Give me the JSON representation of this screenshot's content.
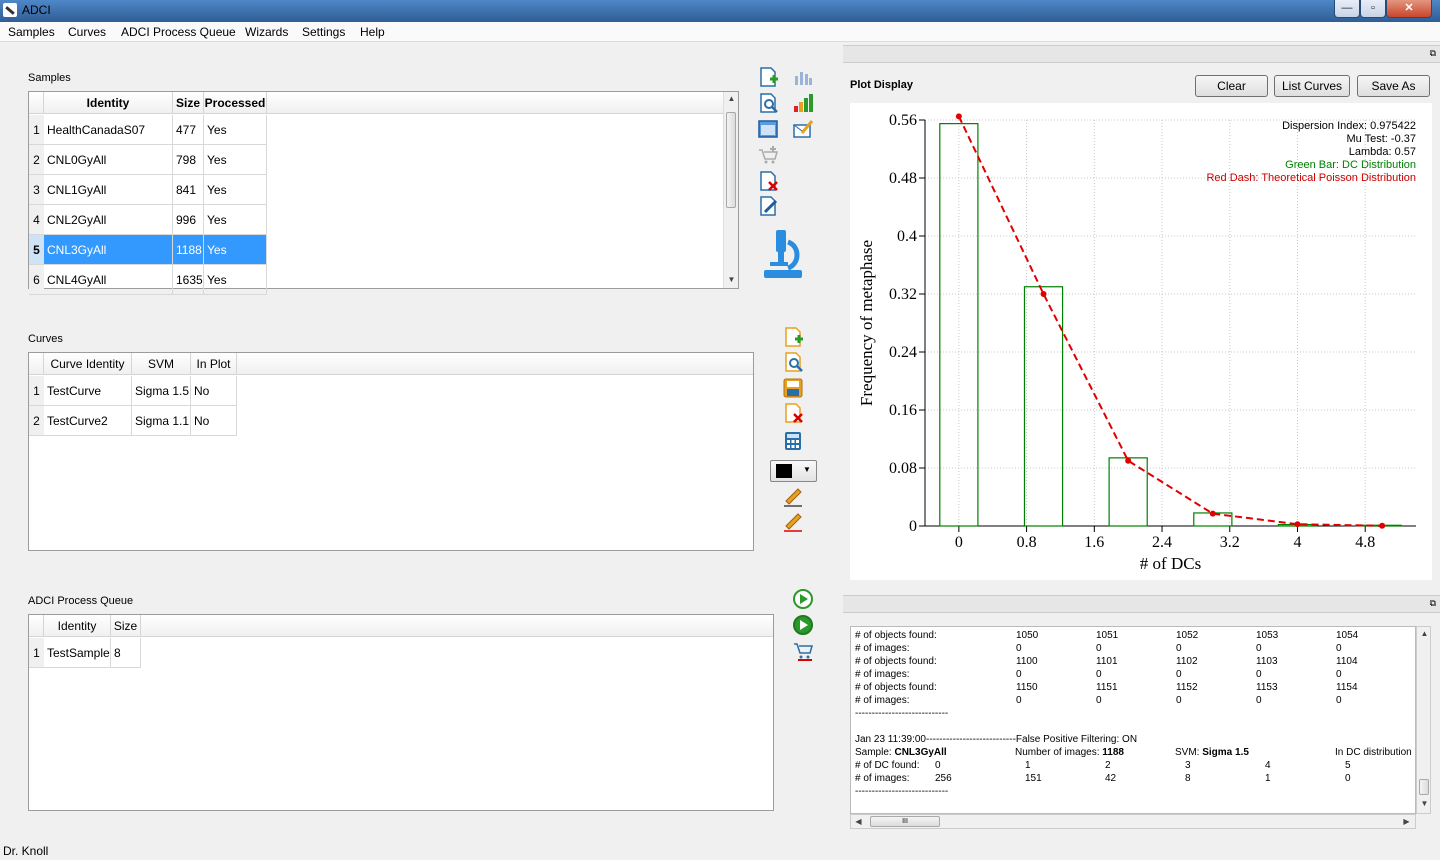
{
  "window": {
    "title": "ADCI",
    "min": "—",
    "max": "▫",
    "close": "✕"
  },
  "menu": [
    "Samples",
    "Curves",
    "ADCI Process Queue",
    "Wizards",
    "Settings",
    "Help"
  ],
  "samples": {
    "label": "Samples",
    "columns": [
      "Identity",
      "Size",
      "Processed"
    ],
    "rows": [
      {
        "n": "1",
        "identity": "HealthCanadaS07",
        "size": "477",
        "processed": "Yes"
      },
      {
        "n": "2",
        "identity": "CNL0GyAll",
        "size": "798",
        "processed": "Yes"
      },
      {
        "n": "3",
        "identity": "CNL1GyAll",
        "size": "841",
        "processed": "Yes"
      },
      {
        "n": "4",
        "identity": "CNL2GyAll",
        "size": "996",
        "processed": "Yes"
      },
      {
        "n": "5",
        "identity": "CNL3GyAll",
        "size": "1188",
        "processed": "Yes"
      },
      {
        "n": "6",
        "identity": "CNL4GyAll",
        "size": "1635",
        "processed": "Yes"
      }
    ],
    "selected_row": 5
  },
  "curves": {
    "label": "Curves",
    "columns": [
      "Curve Identity",
      "SVM",
      "In Plot"
    ],
    "rows": [
      {
        "n": "1",
        "identity": "TestCurve",
        "svm": "Sigma 1.5",
        "inplot": "No"
      },
      {
        "n": "2",
        "identity": "TestCurve2",
        "svm": "Sigma 1.1",
        "inplot": "No"
      }
    ],
    "color_swatch": "#000000"
  },
  "queue": {
    "label": "ADCI Process Queue",
    "columns": [
      "Identity",
      "Size"
    ],
    "rows": [
      {
        "n": "1",
        "identity": "TestSample",
        "size": "8"
      }
    ]
  },
  "plot": {
    "label": "Plot Display",
    "buttons": {
      "clear": "Clear",
      "list": "List Curves",
      "save": "Save As"
    },
    "legend": [
      {
        "text": "Dispersion Index: 0.975422",
        "color": "#000000"
      },
      {
        "text": "Mu Test: -0.37",
        "color": "#000000"
      },
      {
        "text": "Lambda: 0.57",
        "color": "#000000"
      },
      {
        "text": "Green Bar: DC Distribution",
        "color": "#008000"
      },
      {
        "text": "Red Dash: Theoretical Poisson Distribution",
        "color": "#cc0000"
      }
    ]
  },
  "chart_data": {
    "type": "bar",
    "xlabel": "# of DCs",
    "ylabel": "Frequency of metaphase",
    "xlim": [
      -0.4,
      5.4
    ],
    "ylim": [
      0,
      0.56
    ],
    "xticks": [
      "0",
      "0.8",
      "1.6",
      "2.4",
      "3.2",
      "4",
      "4.8"
    ],
    "xtick_values": [
      0,
      0.8,
      1.6,
      2.4,
      3.2,
      4,
      4.8
    ],
    "yticks": [
      "0",
      "0.08",
      "0.16",
      "0.24",
      "0.32",
      "0.4",
      "0.48",
      "0.56"
    ],
    "ytick_values": [
      0,
      0.08,
      0.16,
      0.24,
      0.32,
      0.4,
      0.48,
      0.56
    ],
    "grid": true,
    "series": [
      {
        "kind": "bar",
        "x": [
          0,
          1,
          2,
          3,
          4,
          5
        ],
        "values": [
          0.555,
          0.33,
          0.094,
          0.018,
          0.002,
          0.001
        ],
        "color": "#008000"
      },
      {
        "kind": "line",
        "x": [
          0,
          1,
          2,
          3,
          4,
          5
        ],
        "values": [
          0.565,
          0.32,
          0.09,
          0.017,
          0.0025,
          0.0003
        ],
        "color": "#e00000"
      }
    ]
  },
  "log": {
    "lines": [
      [
        "# of objects found:",
        "1050",
        "1051",
        "1052",
        "1053",
        "1054"
      ],
      [
        "# of images:",
        "0",
        "0",
        "0",
        "0",
        "0"
      ],
      [
        "# of objects found:",
        "1100",
        "1101",
        "1102",
        "1103",
        "1104"
      ],
      [
        "# of images:",
        "0",
        "0",
        "0",
        "0",
        "0"
      ],
      [
        "# of objects found:",
        "1150",
        "1151",
        "1152",
        "1153",
        "1154"
      ],
      [
        "# of images:",
        "0",
        "0",
        "0",
        "0",
        "0"
      ]
    ],
    "sep": "----------------------------",
    "ts": "Jan 23 11:39:00---------------------------False Positive Filtering: ON",
    "sample_lbl": "Sample: ",
    "sample_val": "CNL3GyAll",
    "nimg_lbl": "Number of images: ",
    "nimg_val": "1188",
    "svm_lbl": "SVM: ",
    "svm_val": "Sigma 1.5",
    "indc": "In DC distribution",
    "dc_row": [
      "# of DC found:",
      "0",
      "1",
      "2",
      "3",
      "4",
      "5"
    ],
    "img_row": [
      "# of images:",
      "256",
      "151",
      "42",
      "8",
      "1",
      "0"
    ],
    "sep2": "----------------------------"
  },
  "status": "Dr. Knoll"
}
